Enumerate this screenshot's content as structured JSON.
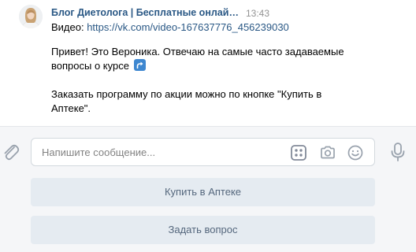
{
  "message": {
    "sender": "Блог Диетолога | Бесплатные онлайн к...",
    "time": "13:43",
    "video_label": "Видео: ",
    "video_url": "https://vk.com/video-167637776_456239030",
    "paragraph1_line1": "Привет! Это Вероника. Отвечаю на самые часто задаваемые",
    "paragraph1_line2": "вопросы о курсе",
    "paragraph1_emoji": "arrow-up-right-icon",
    "paragraph2_line1": "Заказать программу по акции можно по кнопке \"Купить в",
    "paragraph2_line2": "Аптеке\"."
  },
  "composer": {
    "placeholder": "Напишите сообщение...",
    "icons": [
      "paperclip-icon",
      "keyboard-icon",
      "camera-icon",
      "smile-icon",
      "microphone-icon"
    ]
  },
  "keyboard": {
    "buttons": [
      "Купить в Аптеке",
      "Задать вопрос"
    ]
  },
  "colors": {
    "link": "#2a5885",
    "time": "#939393",
    "composer_bg": "#f5f6f8",
    "kb_button_bg": "#e5ebf1",
    "kb_button_text": "#55677d",
    "icon": "#828a99"
  }
}
